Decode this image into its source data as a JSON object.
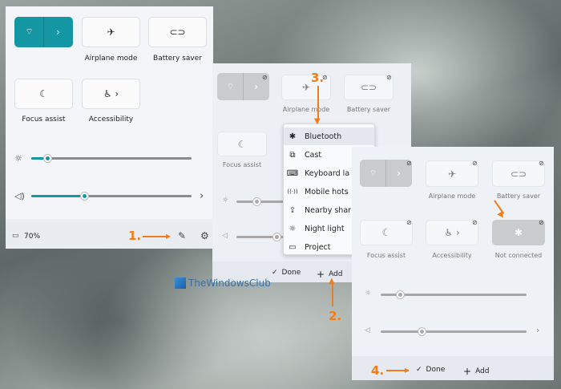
{
  "panel1": {
    "tiles": {
      "airplane_label": "Airplane mode",
      "battery_label": "Battery saver",
      "focus_label": "Focus assist",
      "accessibility_label": "Accessibility"
    },
    "brightness_level": 0.1,
    "volume_level": 0.33,
    "battery_percent": "70%"
  },
  "panel2": {
    "tiles": {
      "airplane_label": "Airplane mode",
      "battery_label": "Battery saver",
      "focus_label": "Focus assist"
    },
    "menu": [
      {
        "icon": "bluetooth-icon",
        "glyph": "✱",
        "label": "Bluetooth"
      },
      {
        "icon": "cast-icon",
        "glyph": "⧉",
        "label": "Cast"
      },
      {
        "icon": "keyboard-icon",
        "glyph": "⌨",
        "label": "Keyboard la"
      },
      {
        "icon": "mobile-hotspot-icon",
        "glyph": "((·))",
        "label": "Mobile hots"
      },
      {
        "icon": "nearby-share-icon",
        "glyph": "⇪",
        "label": "Nearby shar"
      },
      {
        "icon": "night-light-icon",
        "glyph": "☼",
        "label": "Night light"
      },
      {
        "icon": "project-icon",
        "glyph": "▭",
        "label": "Project"
      }
    ],
    "done_label": "Done",
    "add_label": "Add"
  },
  "panel3": {
    "tiles": {
      "airplane_label": "Airplane mode",
      "battery_label": "Battery saver",
      "focus_label": "Focus assist",
      "accessibility_label": "Accessibility",
      "bluetooth_label": "Not connected"
    },
    "done_label": "Done",
    "add_label": "Add"
  },
  "steps": {
    "one": "1.",
    "two": "2.",
    "three": "3.",
    "four": "4."
  },
  "watermark": "TheWindowsClub",
  "colors": {
    "accent": "#1596a3",
    "annotation": "#f07d19"
  }
}
